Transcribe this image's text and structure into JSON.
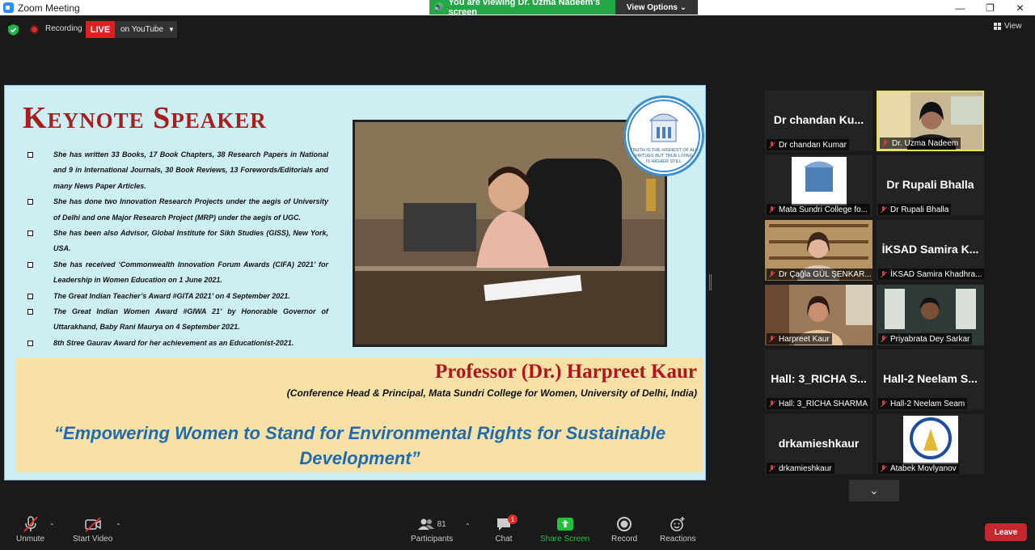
{
  "window": {
    "title": "Zoom Meeting",
    "viewing_banner": "You are viewing Dr. Uzma Nadeem's screen",
    "view_options": "View Options",
    "view_label": "View"
  },
  "status": {
    "recording_label": "Recording",
    "live_label": "LIVE",
    "stream_target": "on YouTube"
  },
  "slide": {
    "title": "Keynote Speaker",
    "bullets": [
      "She has written 33 Books, 17 Book Chapters, 38 Research Papers in National and 9 in International Journals, 30 Book Reviews, 13 Forewords/Editorials and many News Paper Articles.",
      "She has done two Innovation Research Projects under the aegis of University of Delhi and one Major Research Project (MRP) under the aegis of UGC.",
      "She has been also Advisor, Global Institute for Sikh Studies (GISS), New York, USA.",
      "She has received ‘Commonwealth Innovation Forum Awards (CIFA) 2021’ for Leadership in Women Education on 1 June 2021.",
      "The Great Indian Teacher’s Award #GITA 2021’ on 4 September 2021.",
      "The Great Indian Women Award #GIWA 21’ by Honorable Governor of Uttarakhand, Baby Rani Maurya on 4 September 2021.",
      "8th Stree Gaurav Award for her achievement as an Educationist-2021."
    ],
    "logo_motto": "TRUTH IS THE HIGHEST OF ALL VIRTUES BUT TRUE LIVING IS HIGHER STILL",
    "speaker_name": "Professor (Dr.) Harpreet Kaur",
    "speaker_affiliation": "(Conference Head & Principal, Mata Sundri College for Women, University of Delhi, India)",
    "talk_title": "“Empowering Women to Stand for Environmental Rights for Sustainable Development”"
  },
  "gallery": [
    {
      "big": "Dr chandan Ku...",
      "label": "Dr chandan Kumar"
    },
    {
      "big": "",
      "label": "Dr. Uzma Nadeem",
      "active": true
    },
    {
      "big": "",
      "label": "Mata Sundri College fo..."
    },
    {
      "big": "Dr Rupali Bhalla",
      "label": "Dr Rupali Bhalla"
    },
    {
      "big": "",
      "label": "Dr Çağla GÜL ŞENKAR..."
    },
    {
      "big": "İKSAD Samira K...",
      "label": "İKSAD Samira Khadhra..."
    },
    {
      "big": "",
      "label": "Harpreet Kaur"
    },
    {
      "big": "",
      "label": "Priyabrata Dey Sarkar"
    },
    {
      "big": "Hall: 3_RICHA S...",
      "label": "Hall: 3_RICHA SHARMA"
    },
    {
      "big": "Hall-2 Neelam S...",
      "label": "Hall-2 Neelam Seam"
    },
    {
      "big": "drkamieshkaur",
      "label": "drkamieshkaur"
    },
    {
      "big": "",
      "label": "Atabek Movlyanov"
    }
  ],
  "toolbar": {
    "unmute": "Unmute",
    "start_video": "Start Video",
    "participants": "Participants",
    "participant_count": "81",
    "chat": "Chat",
    "chat_badge": "1",
    "share_screen": "Share Screen",
    "record": "Record",
    "reactions": "Reactions",
    "leave": "Leave"
  },
  "colors": {
    "live_red": "#e02020",
    "banner_green": "#23a845",
    "share_green": "#23c03b",
    "leave_red": "#c8262f",
    "slide_bg": "#cdeff3",
    "title_red": "#a81d1d",
    "quote_blue": "#1e6bb0"
  }
}
